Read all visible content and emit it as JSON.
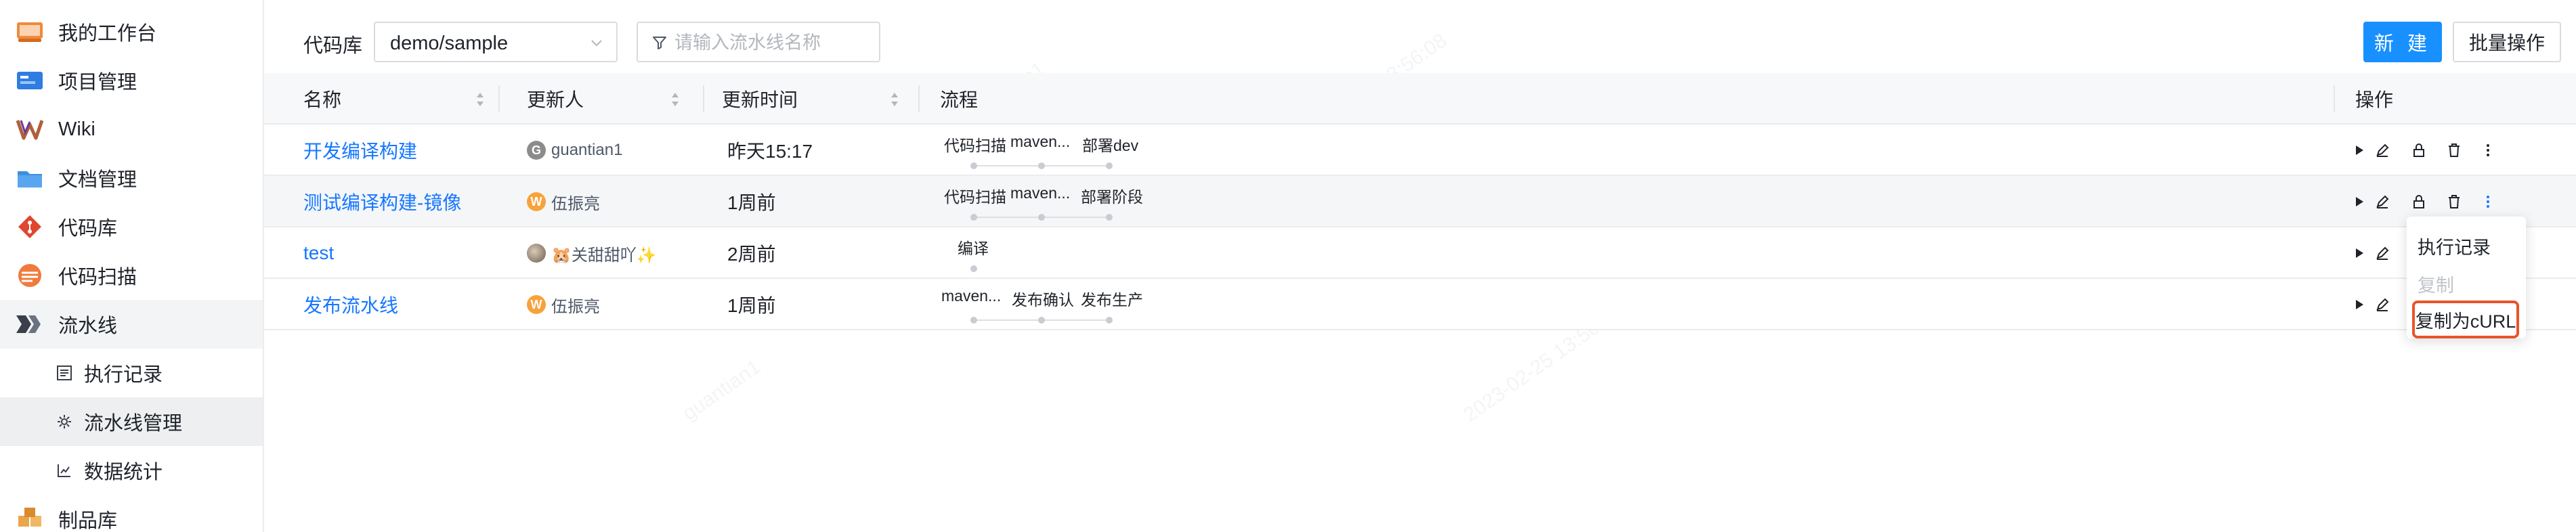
{
  "sidebar": {
    "items": [
      {
        "label": "我的工作台",
        "icon": "workbench-icon"
      },
      {
        "label": "项目管理",
        "icon": "project-icon"
      },
      {
        "label": "Wiki",
        "icon": "wiki-icon"
      },
      {
        "label": "文档管理",
        "icon": "folder-icon"
      },
      {
        "label": "代码库",
        "icon": "git-icon"
      },
      {
        "label": "代码扫描",
        "icon": "scan-icon"
      },
      {
        "label": "流水线",
        "icon": "pipeline-icon"
      },
      {
        "label": "执行记录",
        "icon": "list-icon"
      },
      {
        "label": "流水线管理",
        "icon": "gear-icon"
      },
      {
        "label": "数据统计",
        "icon": "chart-icon"
      },
      {
        "label": "制品库",
        "icon": "artifact-icon"
      }
    ]
  },
  "toolbar": {
    "repo_label": "代码库",
    "repo_value": "demo/sample",
    "search_placeholder": "请输入流水线名称",
    "new_label": "新 建",
    "batch_label": "批量操作"
  },
  "table": {
    "headers": {
      "name": "名称",
      "updater": "更新人",
      "updated": "更新时间",
      "flow": "流程",
      "ops": "操作"
    },
    "rows": [
      {
        "name": "开发编译构建",
        "avatar": "G",
        "updater": "guantian1",
        "time": "昨天15:17",
        "stages": [
          "代码扫描",
          "maven...",
          "部署dev"
        ]
      },
      {
        "name": "测试编译构建-镜像",
        "avatar": "W",
        "updater": "伍振亮",
        "time": "1周前",
        "stages": [
          "代码扫描",
          "maven...",
          "部署阶段"
        ]
      },
      {
        "name": "test",
        "avatar": "",
        "updater": "🐹关甜甜吖✨",
        "time": "2周前",
        "stages": [
          "编译"
        ]
      },
      {
        "name": "发布流水线",
        "avatar": "W",
        "updater": "伍振亮",
        "time": "1周前",
        "stages": [
          "maven...",
          "发布确认",
          "发布生产"
        ]
      }
    ]
  },
  "menu": {
    "items": [
      "执行记录",
      "复制",
      "复制为cURL"
    ]
  },
  "watermark": {
    "user": "guantian1",
    "timestamp": "2023-02-25 13:56:08"
  },
  "colors": {
    "accent": "#1890ff",
    "link": "#1677ff",
    "highlight": "#e8542b"
  }
}
